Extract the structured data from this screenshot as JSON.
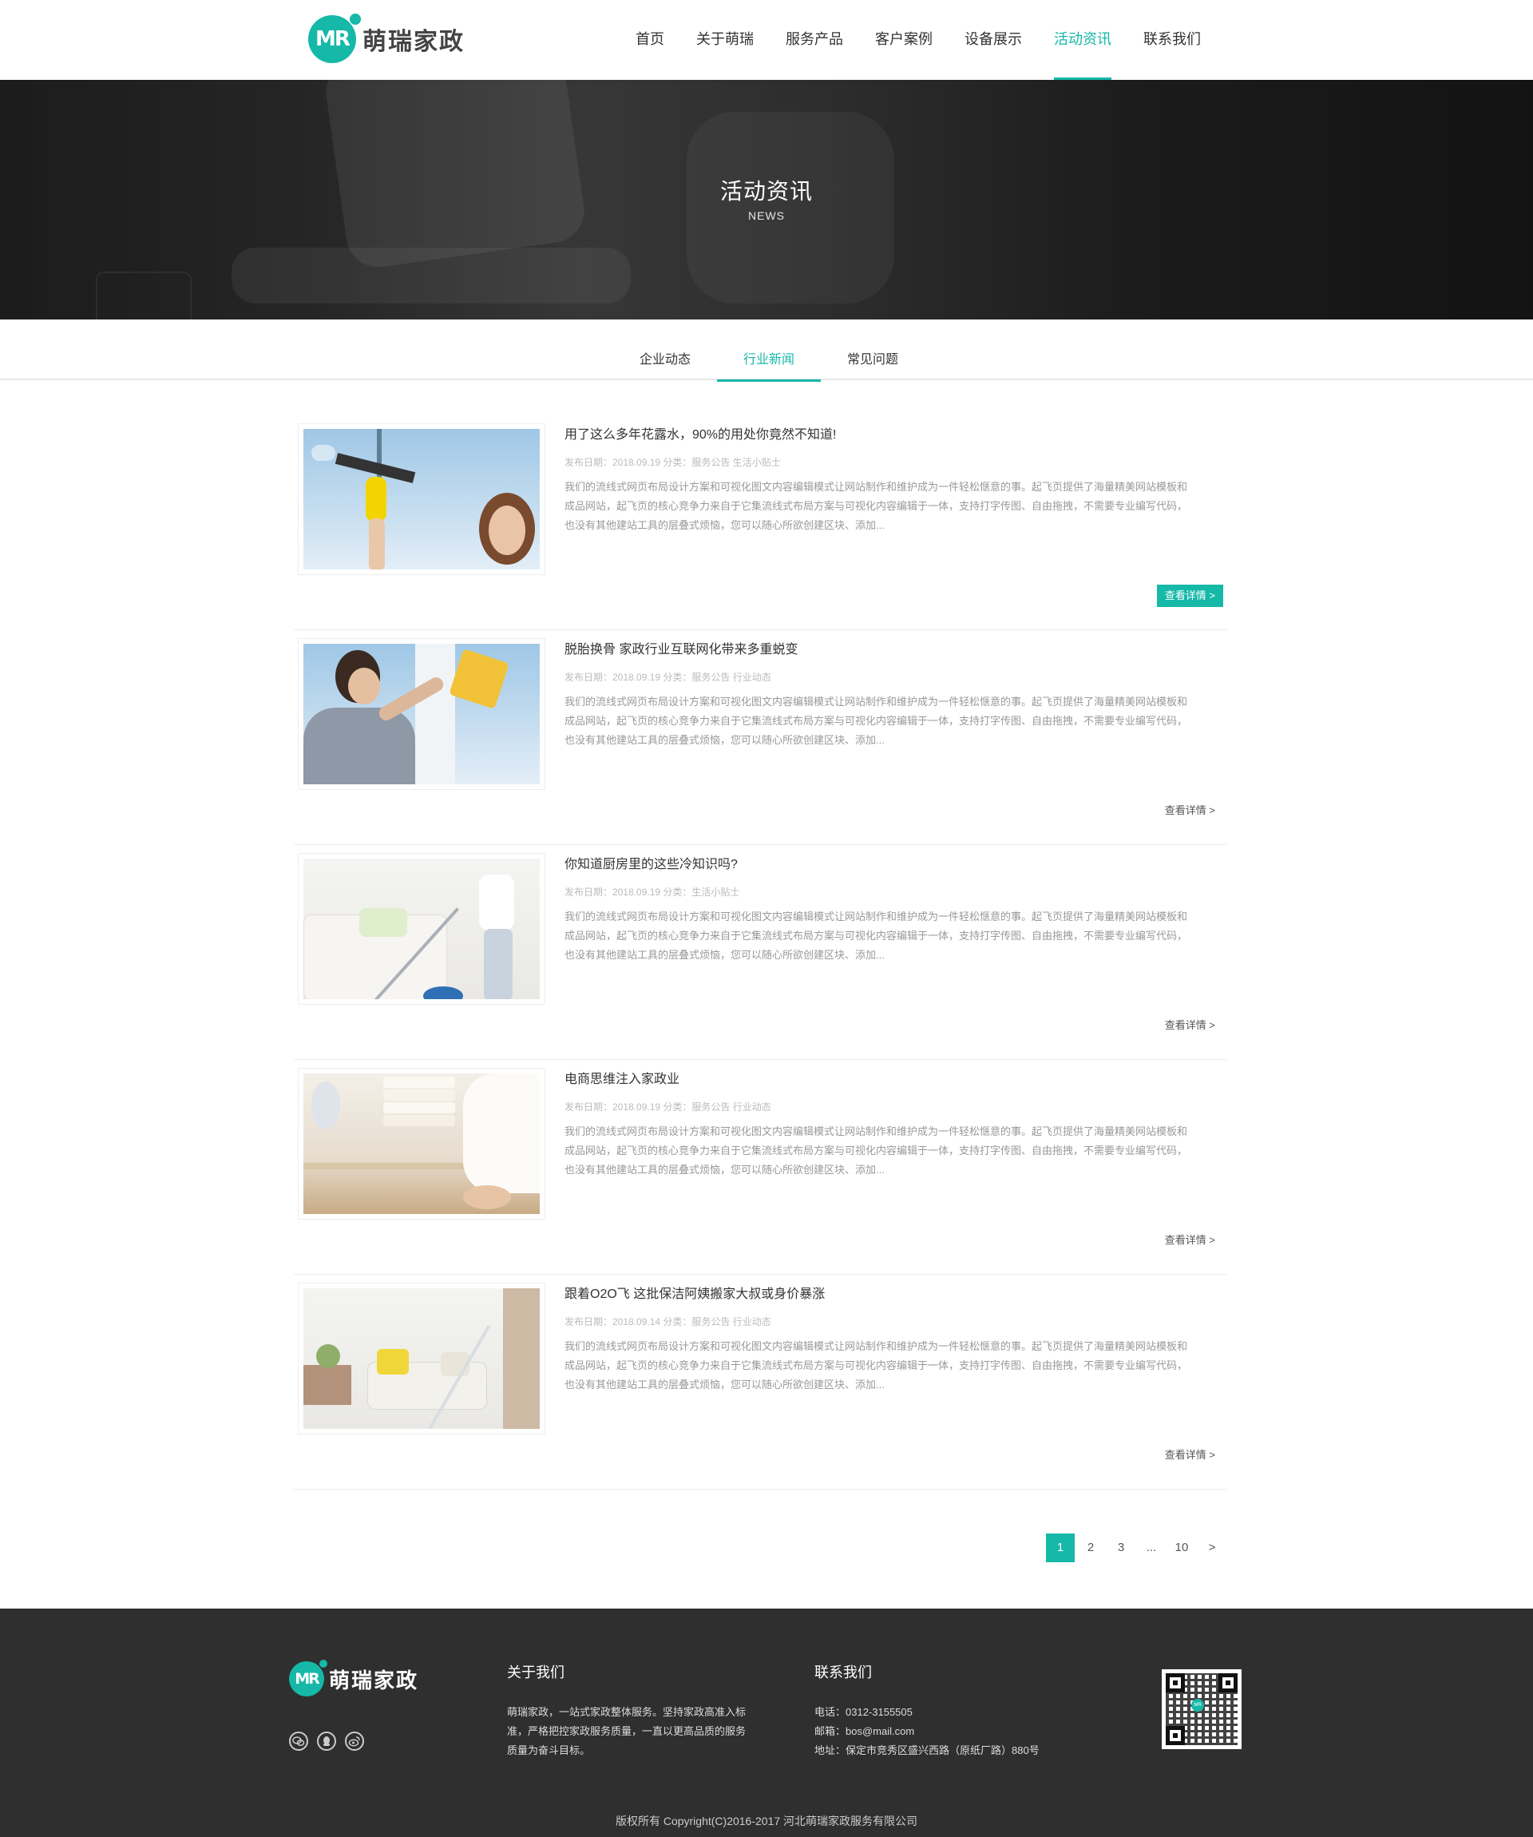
{
  "brand": {
    "logo_mark": "MR",
    "name": "萌瑞家政",
    "accent_color": "#16b8a8"
  },
  "nav": {
    "items": [
      {
        "label": "首页"
      },
      {
        "label": "关于萌瑞"
      },
      {
        "label": "服务产品"
      },
      {
        "label": "客户案例"
      },
      {
        "label": "设备展示"
      },
      {
        "label": "活动资讯",
        "active": true
      },
      {
        "label": "联系我们"
      }
    ]
  },
  "banner": {
    "title": "活动资讯",
    "subtitle": "NEWS"
  },
  "subtabs": [
    {
      "label": "企业动态"
    },
    {
      "label": "行业新闻",
      "active": true
    },
    {
      "label": "常见问题"
    }
  ],
  "articles": [
    {
      "title": "用了这么多年花露水，90%的用处你竟然不知道!",
      "meta": "发布日期：2018.09.19 分类：服务公告 生活小贴士",
      "desc": "我们的流线式网页布局设计方案和可视化图文内容编辑模式让网站制作和维护成为一件轻松惬意的事。起飞页提供了海量精美网站模板和成品网站，起飞页的核心竞争力来自于它集流线式布局方案与可视化内容编辑于一体，支持打字传图、自由拖拽，不需要专业编写代码，也没有其他建站工具的层叠式烦恼，您可以随心所欲创建区块、添加...",
      "more": "查看详情  >",
      "image": "window-squeegee"
    },
    {
      "title": "脱胎换骨 家政行业互联网化带来多重蜕变",
      "meta": "发布日期：2018.09.19 分类：服务公告 行业动态",
      "desc": "我们的流线式网页布局设计方案和可视化图文内容编辑模式让网站制作和维护成为一件轻松惬意的事。起飞页提供了海量精美网站模板和成品网站，起飞页的核心竞争力来自于它集流线式布局方案与可视化内容编辑于一体，支持打字传图、自由拖拽，不需要专业编写代码，也没有其他建站工具的层叠式烦恼，您可以随心所欲创建区块、添加...",
      "more": "查看详情  >",
      "image": "window-cloth"
    },
    {
      "title": "你知道厨房里的这些冷知识吗?",
      "meta": "发布日期：2018.09.19 分类：生活小贴士",
      "desc": "我们的流线式网页布局设计方案和可视化图文内容编辑模式让网站制作和维护成为一件轻松惬意的事。起飞页提供了海量精美网站模板和成品网站，起飞页的核心竞争力来自于它集流线式布局方案与可视化内容编辑于一体，支持打字传图、自由拖拽，不需要专业编写代码，也没有其他建站工具的层叠式烦恼，您可以随心所欲创建区块、添加...",
      "more": "查看详情  >",
      "image": "vacuum-sofa"
    },
    {
      "title": "电商思维注入家政业",
      "meta": "发布日期：2018.09.19 分类：服务公告 行业动态",
      "desc": "我们的流线式网页布局设计方案和可视化图文内容编辑模式让网站制作和维护成为一件轻松惬意的事。起飞页提供了海量精美网站模板和成品网站，起飞页的核心竞争力来自于它集流线式布局方案与可视化内容编辑于一体，支持打字传图、自由拖拽，不需要专业编写代码，也没有其他建站工具的层叠式烦恼，您可以随心所欲创建区块、添加...",
      "more": "查看详情  >",
      "image": "folded-towels"
    },
    {
      "title": "跟着O2O飞 这批保洁阿姨搬家大叔或身价暴涨",
      "meta": "发布日期：2018.09.14 分类：服务公告 行业动态",
      "desc": "我们的流线式网页布局设计方案和可视化图文内容编辑模式让网站制作和维护成为一件轻松惬意的事。起飞页提供了海量精美网站模板和成品网站，起飞页的核心竞争力来自于它集流线式布局方案与可视化内容编辑于一体，支持打字传图、自由拖拽，不需要专业编写代码，也没有其他建站工具的层叠式烦恼，您可以随心所欲创建区块、添加...",
      "more": "查看详情  >",
      "image": "mop-living-room"
    }
  ],
  "pagination": {
    "pages": [
      "1",
      "2",
      "3",
      "...",
      "10",
      ">"
    ],
    "current": "1"
  },
  "footer": {
    "brand_name": "萌瑞家政",
    "social": [
      "wechat-icon",
      "qq-icon",
      "weibo-icon"
    ],
    "about_title": "关于我们",
    "about_text": "萌瑞家政，一站式家政整体服务。坚持家政高准入标准，严格把控家政服务质量，一直以更高品质的服务质量为奋斗目标。",
    "contact_title": "联系我们",
    "phone": "电话：0312-3155505",
    "email": "邮箱：bos@mail.com",
    "address": "地址：保定市竞秀区盛兴西路（原纸厂路）880号",
    "copyright": "版权所有 Copyright(C)2016-2017 河北萌瑞家政服务有限公司"
  }
}
